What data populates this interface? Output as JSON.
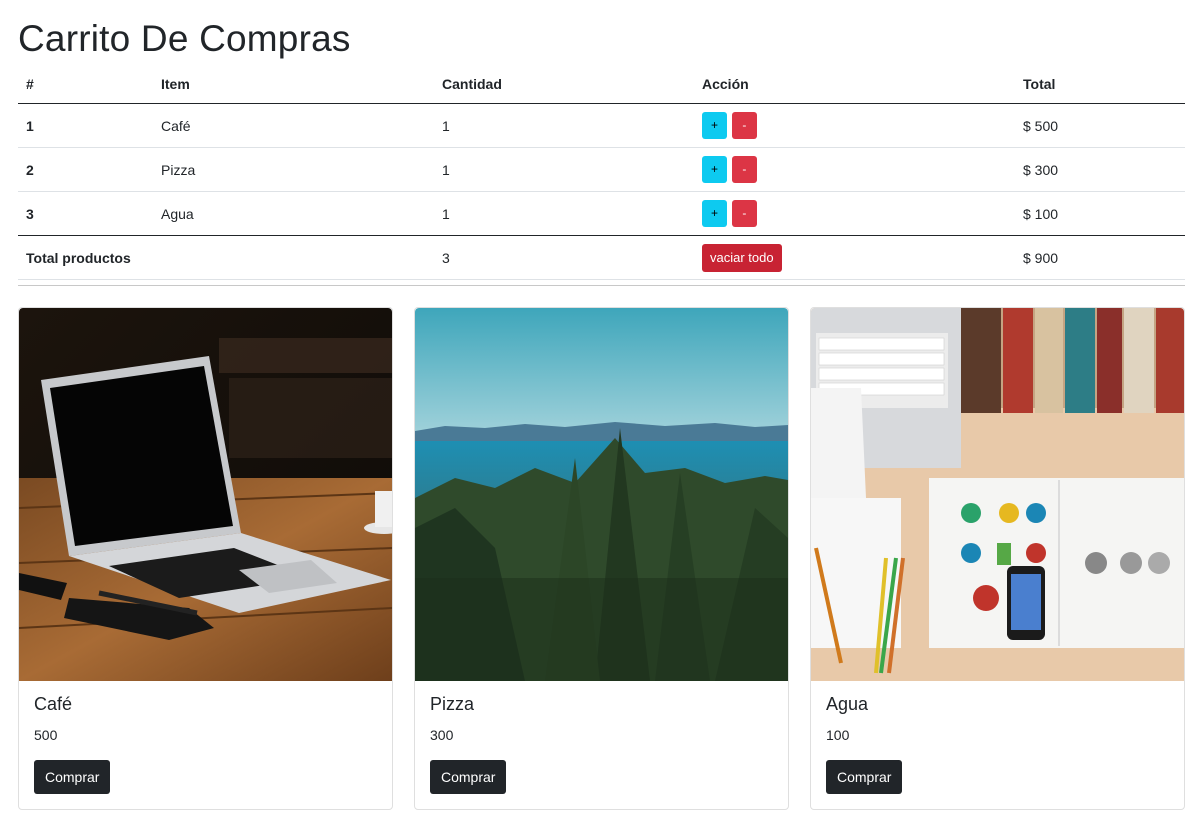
{
  "page": {
    "title": "Carrito De Compras"
  },
  "cart_table": {
    "headers": [
      "#",
      "Item",
      "Cantidad",
      "Acción",
      "Total"
    ],
    "rows": [
      {
        "id": "1",
        "item": "Café",
        "qty": "1",
        "plus": "+",
        "minus": "-",
        "total": "$ 500"
      },
      {
        "id": "2",
        "item": "Pizza",
        "qty": "1",
        "plus": "+",
        "minus": "-",
        "total": "$ 300"
      },
      {
        "id": "3",
        "item": "Agua",
        "qty": "1",
        "plus": "+",
        "minus": "-",
        "total": "$ 100"
      }
    ],
    "footer": {
      "label": "Total productos",
      "qty": "3",
      "clear_label": "vaciar todo",
      "total": "$ 900"
    }
  },
  "products": [
    {
      "name": "Café",
      "price": "500",
      "buy_label": "Comprar",
      "image": "laptop-on-wooden-table-photo"
    },
    {
      "name": "Pizza",
      "price": "300",
      "buy_label": "Comprar",
      "image": "forest-and-sea-landscape-photo"
    },
    {
      "name": "Agua",
      "price": "100",
      "buy_label": "Comprar",
      "image": "desk-with-books-and-magazine-photo"
    }
  ],
  "colors": {
    "info": "#0dcaf0",
    "danger": "#dc3545",
    "dark": "#212529"
  }
}
